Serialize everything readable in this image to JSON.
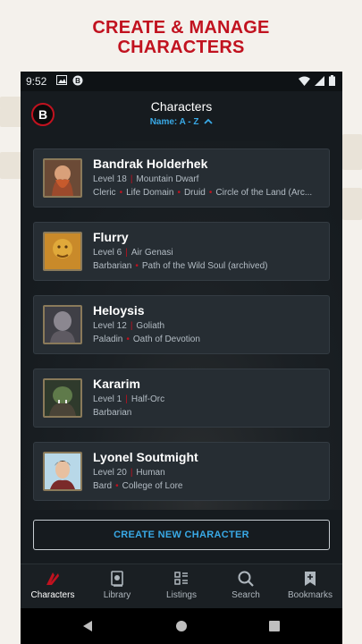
{
  "promo": {
    "title_line1": "CREATE & MANAGE",
    "title_line2": "CHARACTERS"
  },
  "status_bar": {
    "time": "9:52"
  },
  "app_bar": {
    "logo_letter": "B",
    "title": "Characters",
    "sort_label": "Name: A - Z",
    "sort_icon": "chevron-up-icon"
  },
  "characters": [
    {
      "name": "Bandrak Holderhek",
      "level": "Level 18",
      "race": "Mountain Dwarf",
      "classes": "Cleric • Life Domain • Druid • Circle of the Land (Arc..."
    },
    {
      "name": "Flurry",
      "level": "Level 6",
      "race": "Air Genasi",
      "classes": "Barbarian • Path of the Wild Soul (archived)"
    },
    {
      "name": "Heloysis",
      "level": "Level 12",
      "race": "Goliath",
      "classes": "Paladin • Oath of Devotion"
    },
    {
      "name": "Kararim",
      "level": "Level 1",
      "race": "Half-Orc",
      "classes": "Barbarian"
    },
    {
      "name": "Lyonel Soutmight",
      "level": "Level 20",
      "race": "Human",
      "classes": "Bard • College of Lore"
    }
  ],
  "create_button": "CREATE NEW CHARACTER",
  "bottom_nav": [
    {
      "label": "Characters",
      "icon": "characters-icon",
      "active": true
    },
    {
      "label": "Library",
      "icon": "library-icon",
      "active": false
    },
    {
      "label": "Listings",
      "icon": "listings-icon",
      "active": false
    },
    {
      "label": "Search",
      "icon": "search-icon",
      "active": false
    },
    {
      "label": "Bookmarks",
      "icon": "bookmarks-icon",
      "active": false
    }
  ],
  "colors": {
    "accent_red": "#c1121f",
    "accent_blue": "#39a9e6",
    "background": "#161b1f",
    "card": "#262d33"
  }
}
